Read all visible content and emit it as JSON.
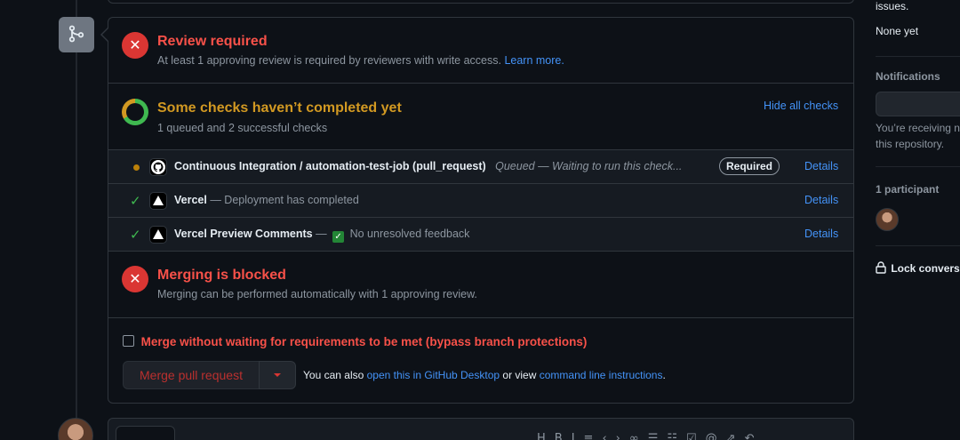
{
  "review": {
    "title": "Review required",
    "subtitle": "At least 1 approving review is required by reviewers with write access.",
    "learn_more": "Learn more."
  },
  "checks": {
    "title": "Some checks haven’t completed yet",
    "subtitle": "1 queued and 2 successful checks",
    "hide_all": "Hide all checks",
    "items": [
      {
        "name": "Continuous Integration / automation-test-job (pull_request)",
        "desc": "Queued — Waiting to run this check...",
        "badge": "Required",
        "details": "Details",
        "status": "queued",
        "app_icon": "github-icon"
      },
      {
        "name": "Vercel",
        "desc": "— Deployment has completed",
        "details": "Details",
        "status": "success",
        "app_icon": "vercel-icon"
      },
      {
        "name": "Vercel Preview Comments",
        "desc_prefix": "—",
        "desc": "No unresolved feedback",
        "details": "Details",
        "status": "success",
        "app_icon": "vercel-icon"
      }
    ]
  },
  "blocked": {
    "title": "Merging is blocked",
    "subtitle": "Merging can be performed automatically with 1 approving review."
  },
  "merge": {
    "bypass_label": "Merge without waiting for requirements to be met (bypass branch protections)",
    "bypass_checked": false,
    "button_label": "Merge pull request",
    "also_prefix": "You can also",
    "desktop_link": "open this in GitHub Desktop",
    "or_view": "or view",
    "cli_link": "command line instructions",
    "suffix": "."
  },
  "sidebar": {
    "issues_tail": "issues.",
    "none_yet": "None yet",
    "notifications_heading": "Notifications",
    "receiving_line1": "You’re receiving n",
    "receiving_line2": "this repository.",
    "participants_heading": "1 participant",
    "lock_label": "Lock conversa"
  },
  "colors": {
    "bg": "#0d1117",
    "border": "#30363d",
    "danger": "#f85149",
    "warning": "#d29922",
    "success": "#3fb950",
    "link": "#4493f8"
  }
}
